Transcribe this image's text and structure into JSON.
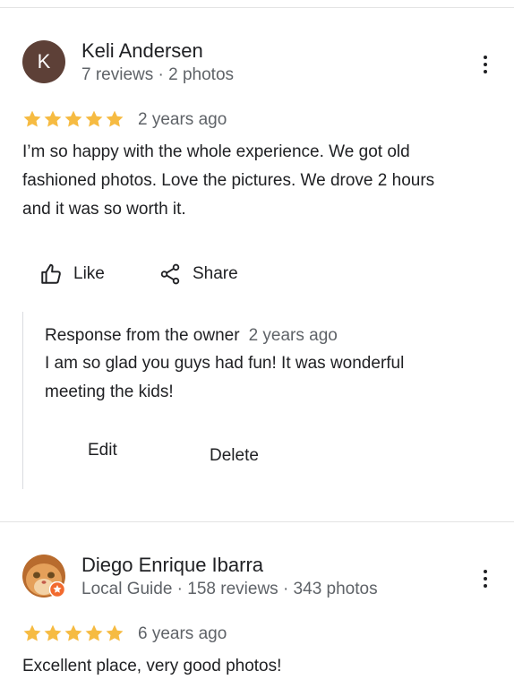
{
  "reviews": [
    {
      "avatar_letter": "K",
      "name": "Keli Andersen",
      "meta": "7 reviews · 2 photos",
      "rating": 5,
      "when": "2 years ago",
      "text_lines": [
        "I’m so happy with the whole experience. We got old",
        "fashioned photos. Love the pictures. We drove 2 hours",
        "and it was so worth it."
      ],
      "like_label": "Like",
      "share_label": "Share",
      "owner_response": {
        "heading": "Response from the owner",
        "when": "2 years ago",
        "text_lines": [
          "I am so glad you guys had fun! It was wonderful",
          "meeting the kids!"
        ],
        "edit_label": "Edit",
        "delete_label": "Delete"
      }
    },
    {
      "name": "Diego Enrique Ibarra",
      "meta": "Local Guide · 158 reviews · 343 photos",
      "rating": 5,
      "when": "6 years ago",
      "text_lines": [
        "Excellent place, very good photos!"
      ]
    }
  ],
  "colors": {
    "star": "#f6bb42",
    "avatar_k": "#5d4037",
    "local_guide_badge": "#f26a2e"
  }
}
